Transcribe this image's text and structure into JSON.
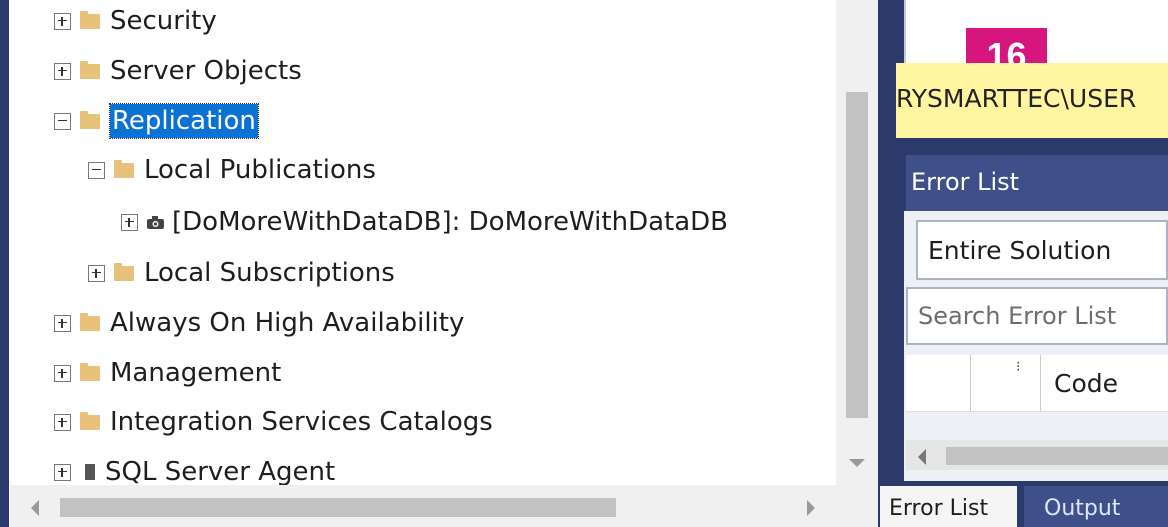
{
  "tree": [
    {
      "label": "Security",
      "expander": "plus",
      "icon": "folder-icon",
      "selected": false
    },
    {
      "label": "Server Objects",
      "expander": "plus",
      "icon": "folder-icon",
      "selected": false
    },
    {
      "label": "Replication",
      "expander": "minus",
      "icon": "folder-icon",
      "selected": true
    },
    {
      "label": "Local Publications",
      "expander": "minus",
      "icon": "folder-icon",
      "selected": false
    },
    {
      "label": "[DoMoreWithDataDB]: DoMoreWithDataDB",
      "expander": "plus",
      "icon": "camera-icon",
      "selected": false
    },
    {
      "label": "Local Subscriptions",
      "expander": "plus",
      "icon": "folder-icon",
      "selected": false
    },
    {
      "label": "Always On High Availability",
      "expander": "plus",
      "icon": "folder-icon",
      "selected": false
    },
    {
      "label": "Management",
      "expander": "plus",
      "icon": "folder-icon",
      "selected": false
    },
    {
      "label": "Integration Services Catalogs",
      "expander": "plus",
      "icon": "folder-icon",
      "selected": false
    },
    {
      "label": "SQL Server Agent",
      "expander": "plus",
      "icon": "agent-icon",
      "selected": false
    }
  ],
  "tab_badge": "16",
  "status_text": "RYSMARTTEC\\USER",
  "error_list": {
    "title": "Error List",
    "scope": "Entire Solution",
    "search_placeholder": "Search Error List",
    "column_code": "Code"
  },
  "bottom_tabs": [
    "Error List",
    "Output"
  ],
  "colors": {
    "selection": "#0a72d6",
    "badge": "#d6167e",
    "status_bar": "#fff5a0",
    "panel_dark": "#2b3a6b"
  }
}
